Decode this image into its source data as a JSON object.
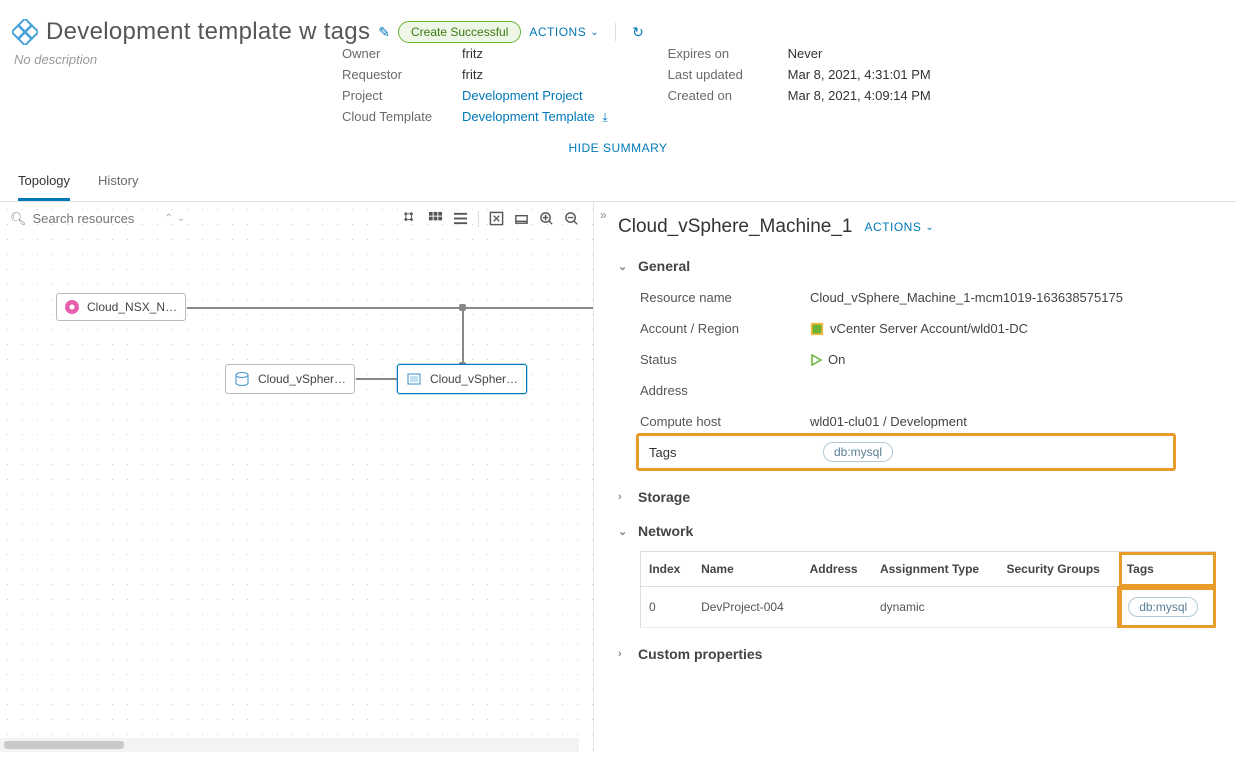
{
  "page": {
    "title": "Development template w tags",
    "status_pill": "Create Successful",
    "actions_label": "ACTIONS",
    "no_description": "No description",
    "hide_summary": "HIDE SUMMARY"
  },
  "meta_left": {
    "owner_label": "Owner",
    "owner_value": "fritz",
    "requestor_label": "Requestor",
    "requestor_value": "fritz",
    "project_label": "Project",
    "project_value": "Development Project",
    "template_label": "Cloud Template",
    "template_value": "Development Template"
  },
  "meta_right": {
    "expires_label": "Expires on",
    "expires_value": "Never",
    "updated_label": "Last updated",
    "updated_value": "Mar 8, 2021, 4:31:01 PM",
    "created_label": "Created on",
    "created_value": "Mar 8, 2021, 4:09:14 PM"
  },
  "tabs": {
    "topology": "Topology",
    "history": "History"
  },
  "search": {
    "placeholder": "Search resources"
  },
  "nodes": {
    "nsx": "Cloud_NSX_N…",
    "db": "Cloud_vSpher…",
    "vm": "Cloud_vSpher…"
  },
  "details": {
    "title": "Cloud_vSphere_Machine_1",
    "actions_label": "ACTIONS",
    "sections": {
      "general": "General",
      "storage": "Storage",
      "network": "Network",
      "custom": "Custom properties"
    },
    "general": {
      "resource_name_label": "Resource name",
      "resource_name": "Cloud_vSphere_Machine_1-mcm1019-163638575175",
      "account_label": "Account / Region",
      "account_value": "vCenter Server Account/wld01-DC",
      "status_label": "Status",
      "status_value": "On",
      "address_label": "Address",
      "compute_label": "Compute host",
      "compute_value": "wld01-clu01 / Development",
      "tags_label": "Tags",
      "tag_value": "db:mysql"
    },
    "network_table": {
      "headers": {
        "index": "Index",
        "name": "Name",
        "address": "Address",
        "assignment": "Assignment Type",
        "security": "Security Groups",
        "tags": "Tags"
      },
      "row": {
        "index": "0",
        "name": "DevProject-004",
        "address": "",
        "assignment": "dynamic",
        "security": "",
        "tag": "db:mysql"
      }
    }
  }
}
